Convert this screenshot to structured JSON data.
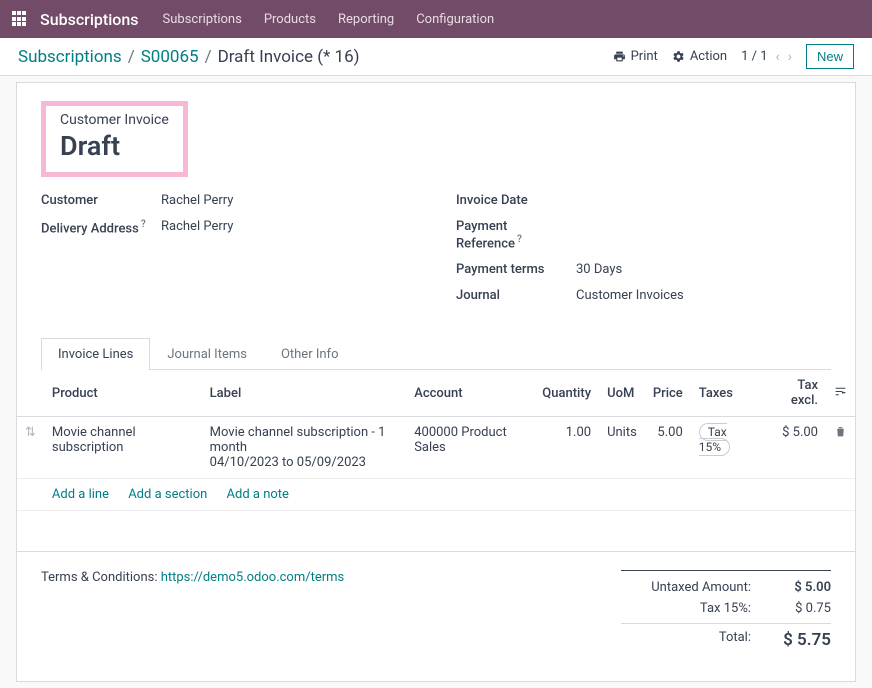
{
  "topbar": {
    "app_name": "Subscriptions",
    "nav": [
      "Subscriptions",
      "Products",
      "Reporting",
      "Configuration"
    ]
  },
  "actionbar": {
    "breadcrumb": [
      "Subscriptions",
      "S00065",
      "Draft Invoice (* 16)"
    ],
    "print_label": "Print",
    "action_label": "Action",
    "pager": "1 / 1",
    "new_label": "New"
  },
  "doc": {
    "type_label": "Customer Invoice",
    "status": "Draft",
    "left_fields": {
      "customer_label": "Customer",
      "customer_value": "Rachel Perry",
      "delivery_label": "Delivery Address",
      "delivery_value": "Rachel Perry"
    },
    "right_fields": {
      "invoice_date_label": "Invoice Date",
      "invoice_date_value": "",
      "payment_ref_label": "Payment Reference",
      "payment_ref_value": "",
      "payment_terms_label": "Payment terms",
      "payment_terms_value": "30 Days",
      "journal_label": "Journal",
      "journal_value": "Customer Invoices"
    }
  },
  "tabs": [
    "Invoice Lines",
    "Journal Items",
    "Other Info"
  ],
  "table": {
    "headers": {
      "product": "Product",
      "label": "Label",
      "account": "Account",
      "quantity": "Quantity",
      "uom": "UoM",
      "price": "Price",
      "taxes": "Taxes",
      "tax_excl": "Tax excl."
    },
    "rows": [
      {
        "product": "Movie channel subscription",
        "label": "Movie channel subscription - 1 month\n04/10/2023 to 05/09/2023",
        "account": "400000 Product Sales",
        "quantity": "1.00",
        "uom": "Units",
        "price": "5.00",
        "tax": "Tax 15%",
        "tax_excl": "$ 5.00"
      }
    ],
    "add_line": "Add a line",
    "add_section": "Add a section",
    "add_note": "Add a note"
  },
  "footer": {
    "terms_label": "Terms & Conditions: ",
    "terms_link": "https://demo5.odoo.com/terms",
    "totals": {
      "untaxed_label": "Untaxed Amount:",
      "untaxed_value": "$ 5.00",
      "tax_label": "Tax 15%:",
      "tax_value": "$ 0.75",
      "total_label": "Total:",
      "total_value": "$ 5.75"
    }
  }
}
